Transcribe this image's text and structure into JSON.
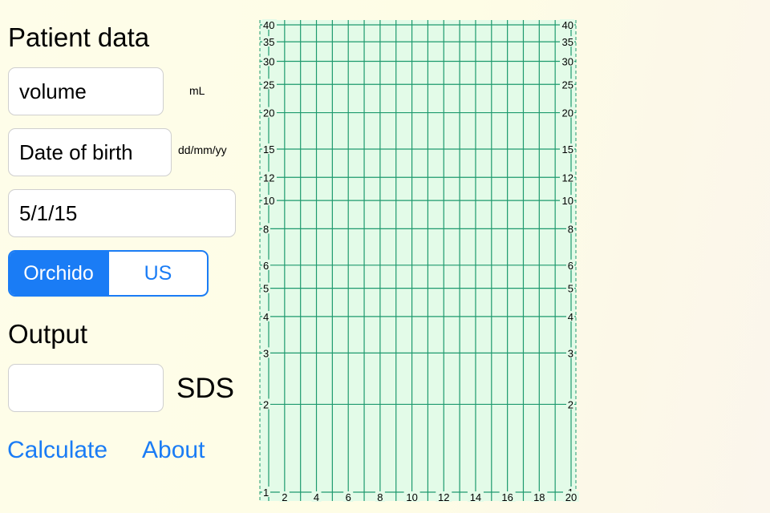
{
  "patient": {
    "title": "Patient data",
    "volume_placeholder": "volume",
    "volume_unit": "mL",
    "dob_placeholder": "Date of birth",
    "dob_unit": "dd/mm/yy",
    "date_value": "5/1/15"
  },
  "method": {
    "options": [
      "Orchido",
      "US"
    ],
    "selected": "Orchido"
  },
  "output": {
    "title": "Output",
    "value": "",
    "unit": "SDS"
  },
  "actions": {
    "calculate_label": "Calculate",
    "about_label": "About"
  },
  "colors": {
    "accent": "#1a7cf5",
    "grid_line": "#1e9a6e",
    "grid_fill": "#e3fbe8"
  },
  "chart_data": {
    "type": "line",
    "title": "",
    "xlabel": "",
    "ylabel": "",
    "x_ticks": [
      "2",
      "4",
      "6",
      "8",
      "10",
      "12",
      "14",
      "16",
      "18",
      "20"
    ],
    "y_ticks": [
      "1",
      "2",
      "3",
      "4",
      "5",
      "6",
      "8",
      "10",
      "12",
      "15",
      "20",
      "25",
      "30",
      "35",
      "40"
    ],
    "xlim": [
      1,
      20
    ],
    "ylim": [
      1,
      40
    ],
    "y_scale": "log",
    "grid": true,
    "series": []
  }
}
